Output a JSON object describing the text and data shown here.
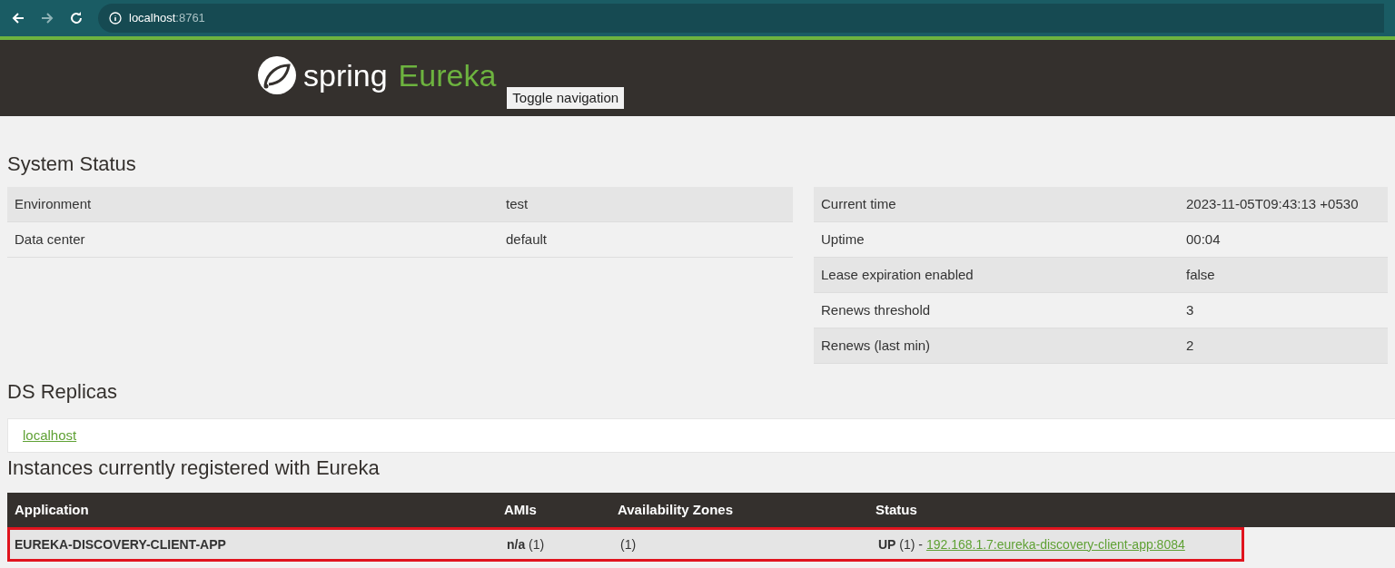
{
  "browser": {
    "host": "localhost",
    "port": ":8761"
  },
  "header": {
    "brand_word": "spring",
    "product": "Eureka",
    "toggle_button": "Toggle navigation"
  },
  "system_status": {
    "title": "System Status",
    "left_rows": [
      {
        "label": "Environment",
        "value": "test"
      },
      {
        "label": "Data center",
        "value": "default"
      }
    ],
    "right_rows": [
      {
        "label": "Current time",
        "value": "2023-11-05T09:43:13 +0530"
      },
      {
        "label": "Uptime",
        "value": "00:04"
      },
      {
        "label": "Lease expiration enabled",
        "value": "false"
      },
      {
        "label": "Renews threshold",
        "value": "3"
      },
      {
        "label": "Renews (last min)",
        "value": "2"
      }
    ]
  },
  "ds_replicas": {
    "title": "DS Replicas",
    "links": [
      "localhost"
    ]
  },
  "instances": {
    "title": "Instances currently registered with Eureka",
    "columns": [
      "Application",
      "AMIs",
      "Availability Zones",
      "Status"
    ],
    "rows": [
      {
        "application": "EUREKA-DISCOVERY-CLIENT-APP",
        "amis": "**n/a** (1)",
        "zones": "(1)",
        "status": "**UP** (1) - ",
        "instance_link": "192.168.1.7:eureka-discovery-client-app:8084",
        "highlighted": true
      }
    ]
  }
}
